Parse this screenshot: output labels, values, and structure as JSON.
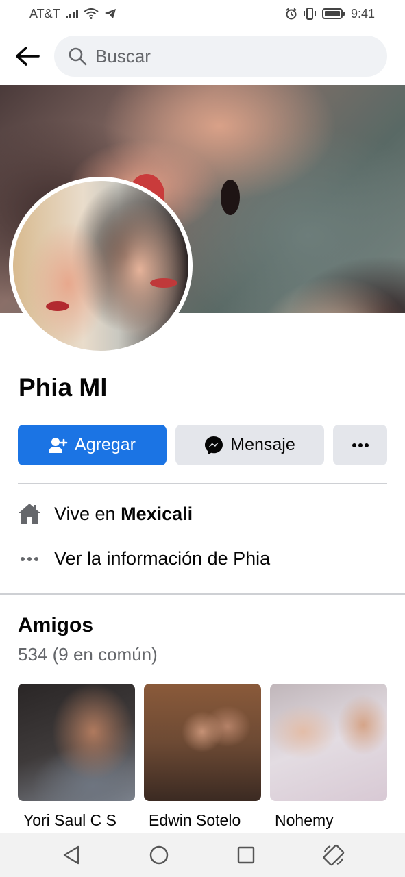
{
  "status_bar": {
    "carrier": "AT&T",
    "time": "9:41"
  },
  "search": {
    "placeholder": "Buscar"
  },
  "profile": {
    "name": "Phia Ml"
  },
  "actions": {
    "add_label": "Agregar",
    "message_label": "Mensaje"
  },
  "info": {
    "lives_prefix": "Vive en ",
    "lives_city": "Mexicali",
    "see_info": "Ver la información de Phia"
  },
  "friends": {
    "title": "Amigos",
    "count": "534 (9 en común)",
    "items": [
      {
        "name": "Yori Saul C S"
      },
      {
        "name": "Edwin Sotelo"
      },
      {
        "name": "Nohemy"
      }
    ]
  },
  "colors": {
    "primary": "#1b74e4",
    "secondary_button": "#e4e6eb",
    "search_bg": "#f0f2f5"
  }
}
